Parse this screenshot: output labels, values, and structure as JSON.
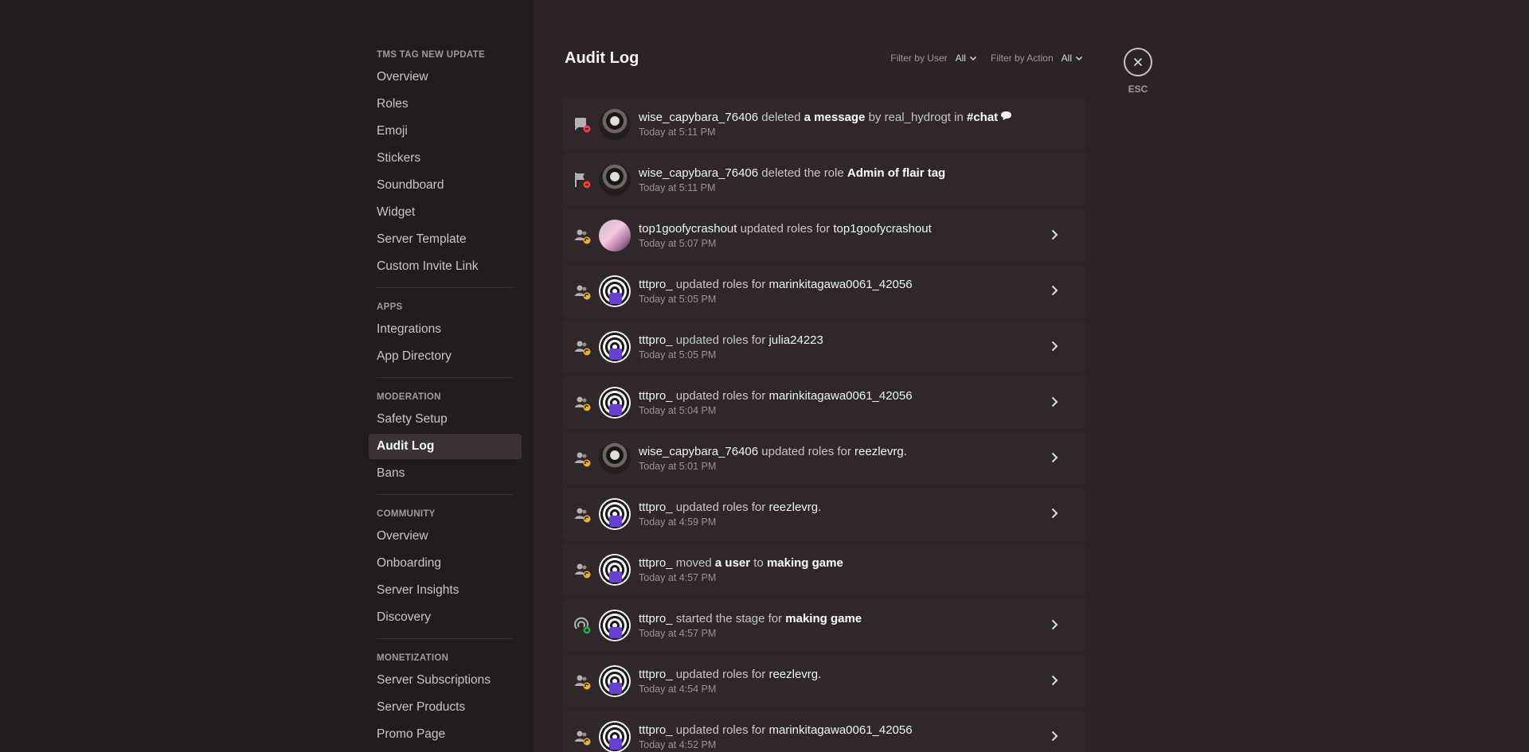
{
  "sidebar": {
    "server_section": {
      "title": "TMS TAG NEW UPDATE",
      "items": [
        "Overview",
        "Roles",
        "Emoji",
        "Stickers",
        "Soundboard",
        "Widget",
        "Server Template",
        "Custom Invite Link"
      ]
    },
    "apps_section": {
      "title": "APPS",
      "items": [
        "Integrations",
        "App Directory"
      ]
    },
    "moderation_section": {
      "title": "MODERATION",
      "items": [
        "Safety Setup",
        "Audit Log",
        "Bans"
      ],
      "active": "Audit Log"
    },
    "community_section": {
      "title": "COMMUNITY",
      "items": [
        "Overview",
        "Onboarding",
        "Server Insights",
        "Discovery"
      ]
    },
    "monetization_section": {
      "title": "MONETIZATION",
      "items": [
        "Server Subscriptions",
        "Server Products",
        "Promo Page"
      ]
    }
  },
  "header": {
    "title": "Audit Log",
    "filter_user_label": "Filter by User",
    "filter_user_value": "All",
    "filter_action_label": "Filter by Action",
    "filter_action_value": "All"
  },
  "close": {
    "esc_label": "ESC"
  },
  "colors": {
    "background": "#2b2325",
    "sidebar": "#231c1e",
    "row": "#2f2729",
    "delete_accent": "#f23f43",
    "update_accent": "#f0b232",
    "create_accent": "#23a55a"
  },
  "log_entries": [
    {
      "icon": "message-delete-icon",
      "avatar": "capy",
      "user": "wise_capybara_76406",
      "parts": [
        " deleted ",
        "a message",
        " by real_hydrogt in ",
        "#chat"
      ],
      "time": "Today at 5:11 PM",
      "expandable": false,
      "chat_icon": true
    },
    {
      "icon": "role-delete-icon",
      "avatar": "capy",
      "user": "wise_capybara_76406",
      "parts": [
        " deleted the role ",
        "Admin of flair tag",
        "",
        ""
      ],
      "time": "Today at 5:11 PM",
      "expandable": false
    },
    {
      "icon": "member-update-icon",
      "avatar": "goofy",
      "user": "top1goofycrashout",
      "parts": [
        " updated roles for ",
        "",
        "top1goofycrashout",
        ""
      ],
      "time": "Today at 5:07 PM",
      "expandable": true
    },
    {
      "icon": "member-update-icon",
      "avatar": "tttpro",
      "user": "tttpro_",
      "parts": [
        " updated roles for ",
        "",
        "marinkitagawa0061_42056",
        ""
      ],
      "time": "Today at 5:05 PM",
      "expandable": true
    },
    {
      "icon": "member-update-icon",
      "avatar": "tttpro",
      "user": "tttpro_",
      "parts": [
        " updated roles for ",
        "",
        "julia24223",
        ""
      ],
      "time": "Today at 5:05 PM",
      "expandable": true
    },
    {
      "icon": "member-update-icon",
      "avatar": "tttpro",
      "user": "tttpro_",
      "parts": [
        " updated roles for ",
        "",
        "marinkitagawa0061_42056",
        ""
      ],
      "time": "Today at 5:04 PM",
      "expandable": true
    },
    {
      "icon": "member-update-icon",
      "avatar": "capy",
      "user": "wise_capybara_76406",
      "parts": [
        " updated roles for ",
        "",
        "reezlevrg.",
        ""
      ],
      "time": "Today at 5:01 PM",
      "expandable": true
    },
    {
      "icon": "member-update-icon",
      "avatar": "tttpro",
      "user": "tttpro_",
      "parts": [
        " updated roles for ",
        "",
        "reezlevrg.",
        ""
      ],
      "time": "Today at 4:59 PM",
      "expandable": true
    },
    {
      "icon": "member-update-icon",
      "avatar": "tttpro",
      "user": "tttpro_",
      "parts": [
        " moved ",
        "a user",
        " to ",
        "making game"
      ],
      "time": "Today at 4:57 PM",
      "expandable": false
    },
    {
      "icon": "stage-start-icon",
      "avatar": "tttpro",
      "user": "tttpro_",
      "parts": [
        " started the stage for ",
        "making game",
        "",
        ""
      ],
      "time": "Today at 4:57 PM",
      "expandable": true
    },
    {
      "icon": "member-update-icon",
      "avatar": "tttpro",
      "user": "tttpro_",
      "parts": [
        " updated roles for ",
        "",
        "reezlevrg.",
        ""
      ],
      "time": "Today at 4:54 PM",
      "expandable": true
    },
    {
      "icon": "member-update-icon",
      "avatar": "tttpro",
      "user": "tttpro_",
      "parts": [
        " updated roles for ",
        "",
        "marinkitagawa0061_42056",
        ""
      ],
      "time": "Today at 4:52 PM",
      "expandable": true
    }
  ]
}
